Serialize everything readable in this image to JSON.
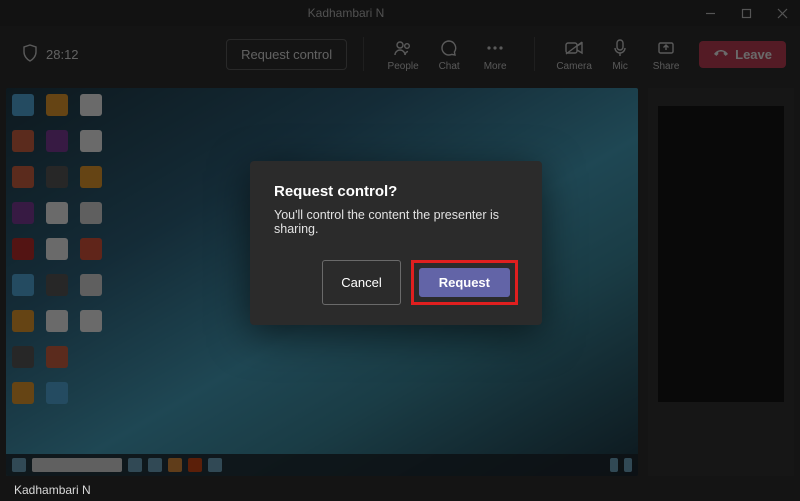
{
  "window": {
    "title": "Kadhambari N"
  },
  "toolbar": {
    "timer": "28:12",
    "request_control": "Request control",
    "people": "People",
    "chat": "Chat",
    "more": "More",
    "camera": "Camera",
    "mic": "Mic",
    "share": "Share",
    "leave": "Leave"
  },
  "dialog": {
    "title": "Request control?",
    "body": "You'll control the content the presenter is sharing.",
    "cancel": "Cancel",
    "request": "Request"
  },
  "caption": "Kadhambari N"
}
